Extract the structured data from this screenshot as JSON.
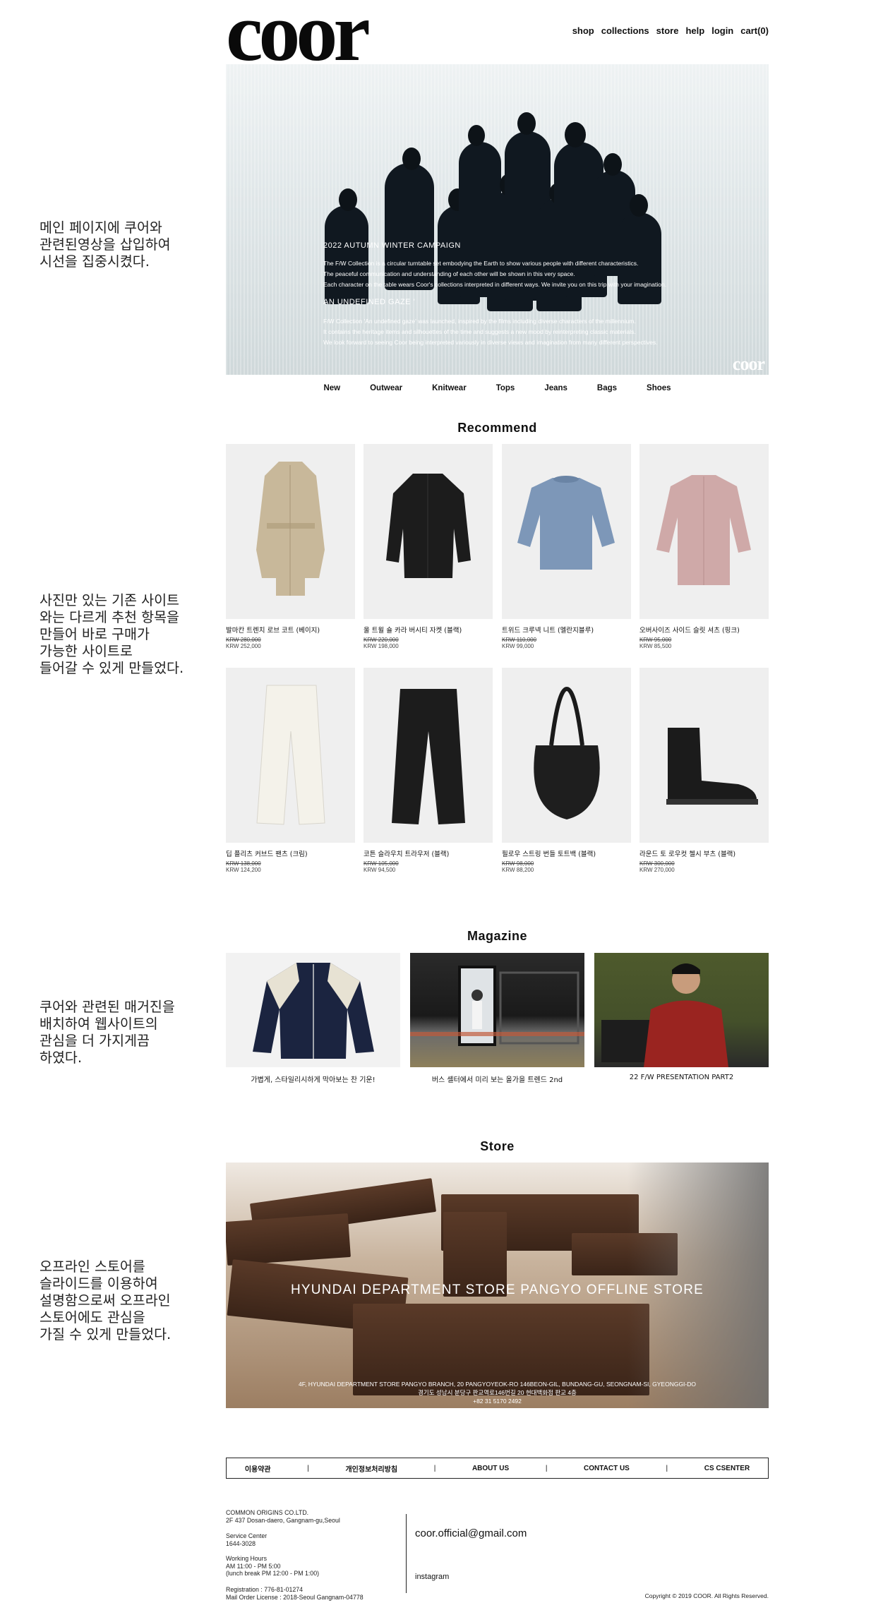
{
  "side_notes": [
    "메인 페이지에 쿠어와\n관련된영상을 삽입하여\n시선을 집중시켰다.",
    "사진만 있는 기존 사이트\n와는 다르게 추천 항목을\n만들어 바로 구매가\n가능한 사이트로\n들어갈 수 있게 만들었다.",
    "쿠어와 관련된 매거진을\n배치하여 웹사이트의\n관심을 더 가지게끔\n하였다.",
    "오프라인 스토어를\n슬라이드를 이용하여\n설명함으로써 오프라인\n스토어에도 관심을\n가질 수 있게 만들었다."
  ],
  "header": {
    "logo": "coor",
    "nav": [
      "shop",
      "collections",
      "store",
      "help",
      "login",
      "cart(0)"
    ]
  },
  "hero": {
    "campaign_title": "2022 AUTUMN WINTER CAMPAIGN",
    "lines1": [
      "The F/W Collection is a circular turntable set embodying the Earth to show various people with different characteristics.",
      "The peaceful communication and understanding of each other will be shown in this very space.",
      "Each character on the table wears Coor's collections interpreted in different ways. We invite you on this trip with your imagination."
    ],
    "subtitle": "AN UNDEFINED GAZE '",
    "lines2": [
      "F/W Collection 'An undefined gaze' was launched, inspired by the films including diverse characters of the millennium.",
      "It contains the heritage items and silhouettes of the time and suggests a new mood by reinterpreting classic materials.",
      "We look forward to seeing Coor being interpreted variously in diverse views and imagination from many different perspectives."
    ],
    "watermark": "coor"
  },
  "categories": [
    "New",
    "Outwear",
    "Knitwear",
    "Tops",
    "Jeans",
    "Bags",
    "Shoes"
  ],
  "recommend": {
    "title": "Recommend",
    "products": [
      {
        "name": "발마칸 트렌치 로브 코트 (베이지)",
        "orig": "KRW 280,000",
        "sale": "KRW 252,000",
        "icon": "trench-coat-icon"
      },
      {
        "name": "울 트윌 숄 카라 버시티 자켓 (블랙)",
        "orig": "KRW 220,000",
        "sale": "KRW 198,000",
        "icon": "jacket-icon"
      },
      {
        "name": "트위드 크루넥 니트 (멜란지블루)",
        "orig": "KRW 110,000",
        "sale": "KRW 99,000",
        "icon": "sweater-icon"
      },
      {
        "name": "오버사이즈 사이드 슬릿 셔츠 (핑크)",
        "orig": "KRW 95,000",
        "sale": "KRW 85,500",
        "icon": "shirt-icon"
      },
      {
        "name": "딥 플리츠 커브드 팬츠 (크림)",
        "orig": "KRW 138,000",
        "sale": "KRW 124,200",
        "icon": "pants-icon"
      },
      {
        "name": "코튼 슬라우치 트라우저 (블랙)",
        "orig": "KRW 105,000",
        "sale": "KRW 94,500",
        "icon": "trousers-icon"
      },
      {
        "name": "필로우 스트링 번들 토트백 (블랙)",
        "orig": "KRW 98,000",
        "sale": "KRW 88,200",
        "icon": "tote-bag-icon"
      },
      {
        "name": "라운드 토 로우컷 첼시 부츠 (블랙)",
        "orig": "KRW 300,000",
        "sale": "KRW 270,000",
        "icon": "boots-icon"
      }
    ]
  },
  "magazine": {
    "title": "Magazine",
    "items": [
      {
        "caption": "가볍게, 스타일리시하게 막아보는 찬 기운!"
      },
      {
        "caption": "버스 셸터에서 미리 보는 올가을 트렌드 2nd"
      },
      {
        "caption": "22 F/W PRESENTATION PART2"
      }
    ]
  },
  "store": {
    "title": "Store",
    "name": "HYUNDAI DEPARTMENT STORE PANGYO OFFLINE STORE",
    "address_en": "4F, HYUNDAI DEPARTMENT STORE PANGYO BRANCH, 20 PANGYOYEOK-RO 146BEON-GIL, BUNDANG-GU, SEONGNAM-SI, GYEONGGI-DO",
    "address_ko": "경기도 성남시 분당구 판교역로146번길 20 현대백화점 판교 4층",
    "phone": "+82 31 5170 2492"
  },
  "footer": {
    "links": [
      "이용약관",
      "개인정보처리방침",
      "ABOUT US",
      "CONTACT US",
      "CS CSENTER"
    ],
    "sep": "|",
    "company": "COMMON ORIGINS CO.LTD.",
    "address": "2F 437 Dosan-daero, Gangnam-gu,Seoul",
    "service_label": "Service Center",
    "service_phone": "1644-3028",
    "hours_label": "Working Hours",
    "hours": "AM 11:00 - PM 5:00",
    "lunch": "(lunch break PM 12:00 - PM 1:00)",
    "registration": "Registration : 776-81-01274",
    "license": "Mail Order License : 2018-Seoul Gangnam-04778",
    "email": "coor.official@gmail.com",
    "instagram": "instagram",
    "copyright": "Copyright © 2019 COOR. All Rights Reserved."
  }
}
